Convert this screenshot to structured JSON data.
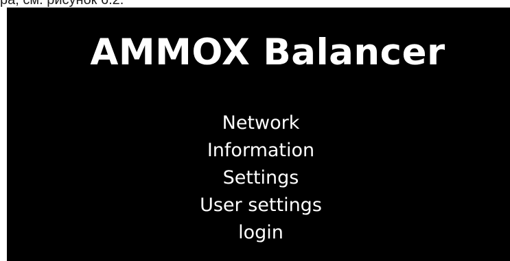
{
  "document": {
    "caption_fragment": "ра, см. рисунок 6.2."
  },
  "app": {
    "title": "AMMOX Balancer"
  },
  "menu": {
    "items": [
      {
        "label": "Network"
      },
      {
        "label": "Information"
      },
      {
        "label": "Settings"
      },
      {
        "label": "User settings"
      },
      {
        "label": "login"
      }
    ]
  },
  "colors": {
    "screen_background": "#000000",
    "text": "#ffffff",
    "page_background": "#ffffff"
  }
}
